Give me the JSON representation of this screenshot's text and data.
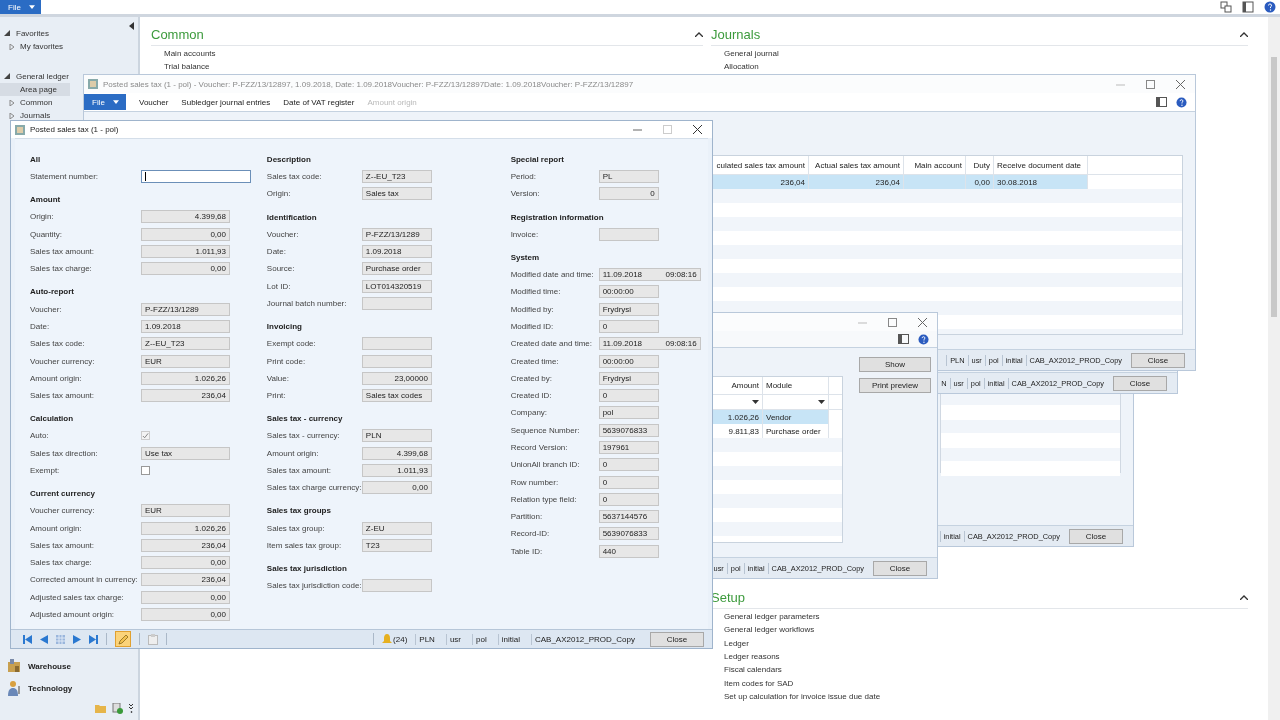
{
  "app": {
    "file_menu": "File",
    "sidebar": {
      "groups": [
        {
          "label": "Favorites",
          "expanded": true,
          "children": [
            {
              "label": "My favorites",
              "expanded": false,
              "selected": false
            }
          ]
        },
        {
          "label": "General ledger",
          "expanded": true,
          "children": [
            {
              "label": "Area page",
              "selected": true
            },
            {
              "label": "Common",
              "expanded": false,
              "selected": false
            },
            {
              "label": "Journals",
              "expanded": false,
              "selected": false
            }
          ]
        }
      ],
      "modules": [
        "Warehouse",
        "Technology"
      ]
    },
    "sections": [
      {
        "title": "Common",
        "expanded": true,
        "links": [
          "Main accounts",
          "Trial balance"
        ]
      },
      {
        "title": "Journals",
        "expanded": true,
        "links": [
          "General journal",
          "Allocation"
        ]
      },
      {
        "title": "Setup",
        "expanded": true,
        "links": [
          "General ledger parameters",
          "General ledger workflows",
          "Ledger",
          "Ledger reasons",
          "Fiscal calendars",
          "Item codes for SAD",
          "Set up calculation for invoice issue due date"
        ]
      }
    ]
  },
  "voucher_window": {
    "title": "Posted sales tax (1 - pol) - Voucher: P-FZZ/13/12897, 1.09.2018, Date: 1.09.2018Voucher: P-FZZ/13/12897Date: 1.09.2018Voucher: P-FZZ/13/12897",
    "menu": [
      {
        "label": "File",
        "kind": "file",
        "disabled": false
      },
      {
        "label": "Voucher",
        "kind": "item",
        "disabled": false
      },
      {
        "label": "Subledger journal entries",
        "kind": "item",
        "disabled": false
      },
      {
        "label": "Date of VAT register",
        "kind": "item",
        "disabled": false
      },
      {
        "label": "Amount origin",
        "kind": "item",
        "disabled": true
      }
    ],
    "grid": {
      "columns": [
        "culated sales tax amount",
        "Actual sales tax amount",
        "Main account",
        "Duty",
        "Receive document date"
      ],
      "rows": [
        {
          "cells": [
            "236,04",
            "236,04",
            null,
            "0,00",
            "30.08.2018"
          ],
          "selected": true
        }
      ]
    },
    "status": [
      "PLN",
      "usr",
      "pol",
      "initial",
      "CAB_AX2012_PROD_Copy"
    ],
    "close": "Close"
  },
  "window_d": {
    "status": [
      "N",
      "usr",
      "pol",
      "initial",
      "CAB_AX2012_PROD_Copy"
    ],
    "close": "Close"
  },
  "window_c": {
    "status": [
      "initial",
      "CAB_AX2012_PROD_Copy"
    ],
    "close": "Close"
  },
  "window_b": {
    "buttons": [
      "Show",
      "Print preview"
    ],
    "grid": {
      "columns": [
        "Amount",
        "Module"
      ],
      "rows": [
        {
          "cells": [
            "1.026,26",
            "Vendor"
          ],
          "selected": true
        },
        {
          "cells": [
            "9.811,83",
            "Purchase order"
          ],
          "selected": false
        }
      ]
    },
    "status": [
      "usr",
      "pol",
      "initial",
      "CAB_AX2012_PROD_Copy"
    ],
    "close": "Close"
  },
  "dialog": {
    "title": "Posted sales tax (1 - pol)",
    "columns": [
      [
        {
          "title": "All",
          "fields": [
            {
              "label": "Statement number:",
              "kind": "text",
              "focused": true
            }
          ]
        },
        {
          "title": "Amount",
          "fields": [
            {
              "label": "Origin:",
              "kind": "number",
              "value": "4.399,68"
            },
            {
              "label": "Quantity:",
              "kind": "number",
              "value": "0,00"
            },
            {
              "label": "Sales tax amount:",
              "kind": "number",
              "value": "1.011,93"
            },
            {
              "label": "Sales tax charge:",
              "kind": "number",
              "value": "0,00"
            }
          ]
        },
        {
          "title": "Auto-report",
          "fields": [
            {
              "label": "Voucher:",
              "kind": "text",
              "value": "P-FZZ/13/1289"
            },
            {
              "label": "Date:",
              "kind": "text",
              "value": "1.09.2018"
            },
            {
              "label": "Sales tax code:",
              "kind": "text",
              "value": "Z--EU_T23"
            },
            {
              "label": "Voucher currency:",
              "kind": "text",
              "value": "EUR"
            },
            {
              "label": "Amount origin:",
              "kind": "number",
              "value": "1.026,26"
            },
            {
              "label": "Sales tax amount:",
              "kind": "number",
              "value": "236,04"
            }
          ]
        },
        {
          "title": "Calculation",
          "fields": [
            {
              "label": "Auto:",
              "kind": "checkbox",
              "checked": true,
              "disabled": true
            },
            {
              "label": "Sales tax direction:",
              "kind": "text",
              "value": "Use tax"
            },
            {
              "label": "Exempt:",
              "kind": "checkbox",
              "checked": false,
              "disabled": false
            }
          ]
        },
        {
          "title": "Current currency",
          "fields": [
            {
              "label": "Voucher currency:",
              "kind": "text",
              "value": "EUR"
            },
            {
              "label": "Amount origin:",
              "kind": "number",
              "value": "1.026,26"
            },
            {
              "label": "Sales tax amount:",
              "kind": "number",
              "value": "236,04"
            },
            {
              "label": "Sales tax charge:",
              "kind": "number",
              "value": "0,00"
            },
            {
              "label": "Corrected amount in currency:",
              "kind": "number",
              "value": "236,04"
            },
            {
              "label": "Adjusted sales tax charge:",
              "kind": "number",
              "value": "0,00"
            },
            {
              "label": "Adjusted amount origin:",
              "kind": "number",
              "value": "0,00"
            }
          ]
        }
      ],
      [
        {
          "title": "Description",
          "fields": [
            {
              "label": "Sales tax code:",
              "kind": "text",
              "value": "Z--EU_T23"
            },
            {
              "label": "Origin:",
              "kind": "text",
              "value": "Sales tax"
            }
          ]
        },
        {
          "title": "Identification",
          "fields": [
            {
              "label": "Voucher:",
              "kind": "text",
              "value": "P-FZZ/13/1289"
            },
            {
              "label": "Date:",
              "kind": "text",
              "value": "1.09.2018"
            },
            {
              "label": "Source:",
              "kind": "text",
              "value": "Purchase order"
            },
            {
              "label": "Lot ID:",
              "kind": "text",
              "value": "LOT014320519"
            },
            {
              "label": "Journal batch number:",
              "kind": "text"
            }
          ]
        },
        {
          "title": "Invoicing",
          "fields": [
            {
              "label": "Exempt code:",
              "kind": "text"
            },
            {
              "label": "Print code:",
              "kind": "text"
            },
            {
              "label": "Value:",
              "kind": "number",
              "value": "23,00000"
            },
            {
              "label": "Print:",
              "kind": "text",
              "value": "Sales tax codes"
            }
          ]
        },
        {
          "title": "Sales tax - currency",
          "fields": [
            {
              "label": "Sales tax - currency:",
              "kind": "text",
              "value": "PLN"
            },
            {
              "label": "Amount origin:",
              "kind": "number",
              "value": "4.399,68"
            },
            {
              "label": "Sales tax amount:",
              "kind": "number",
              "value": "1.011,93"
            },
            {
              "label": "Sales tax charge currency:",
              "kind": "number",
              "value": "0,00"
            }
          ]
        },
        {
          "title": "Sales tax groups",
          "fields": [
            {
              "label": "Sales tax group:",
              "kind": "text",
              "value": "Z-EU"
            },
            {
              "label": "Item sales tax group:",
              "kind": "text",
              "value": "T23"
            }
          ]
        },
        {
          "title": "Sales tax jurisdiction",
          "fields": [
            {
              "label": "Sales tax jurisdiction code:",
              "kind": "text"
            }
          ]
        }
      ],
      [
        {
          "title": "Special report",
          "fields": [
            {
              "label": "Period:",
              "kind": "text",
              "value": "PL"
            },
            {
              "label": "Version:",
              "kind": "number",
              "value": "0"
            }
          ]
        },
        {
          "title": "Registration information",
          "fields": [
            {
              "label": "Invoice:",
              "kind": "text"
            }
          ]
        },
        {
          "title": "System",
          "fields": [
            {
              "label": "Modified date and time:",
              "kind": "datetime",
              "value": "11.09.2018",
              "time": "09:08:16"
            },
            {
              "label": "Modified time:",
              "kind": "text",
              "value": "00:00:00"
            },
            {
              "label": "Modified by:",
              "kind": "text",
              "value": "Frydrysi"
            },
            {
              "label": "Modified ID:",
              "kind": "text",
              "value": "0"
            },
            {
              "label": "Created date and time:",
              "kind": "datetime",
              "value": "11.09.2018",
              "time": "09:08:16"
            },
            {
              "label": "Created time:",
              "kind": "text",
              "value": "00:00:00"
            },
            {
              "label": "Created by:",
              "kind": "text",
              "value": "Frydrysi"
            },
            {
              "label": "Created ID:",
              "kind": "text",
              "value": "0"
            },
            {
              "label": "Company:",
              "kind": "text",
              "value": "pol"
            },
            {
              "label": "Sequence Number:",
              "kind": "text",
              "value": "5639076833"
            },
            {
              "label": "Record Version:",
              "kind": "text",
              "value": "197961"
            },
            {
              "label": "UnionAll branch ID:",
              "kind": "text",
              "value": "0"
            },
            {
              "label": "Row number:",
              "kind": "text",
              "value": "0"
            },
            {
              "label": "Relation type field:",
              "kind": "text",
              "value": "0"
            },
            {
              "label": "Partition:",
              "kind": "text",
              "value": "5637144576"
            },
            {
              "label": "Record-ID:",
              "kind": "text",
              "value": "5639076833"
            },
            {
              "label": "Table ID:",
              "kind": "text",
              "value": "440"
            }
          ]
        }
      ]
    ],
    "edit_mode": true,
    "notifications": "(24)",
    "status": [
      "PLN",
      "usr",
      "pol",
      "initial",
      "CAB_AX2012_PROD_Copy"
    ],
    "close": "Close"
  }
}
